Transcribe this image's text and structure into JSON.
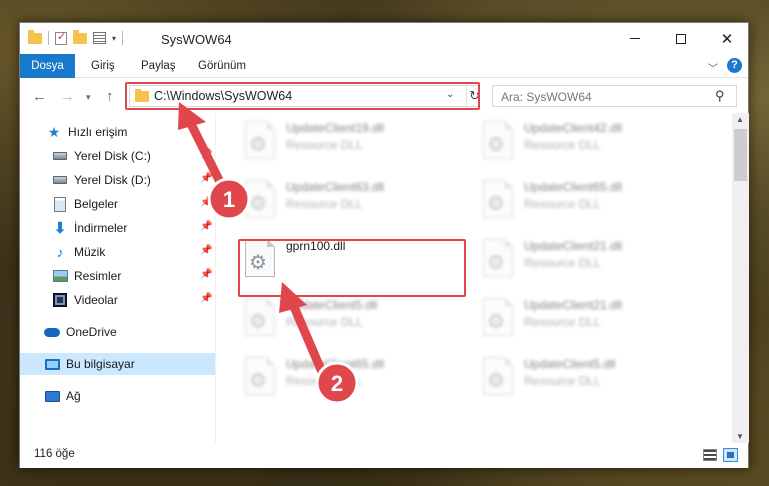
{
  "window": {
    "title": "SysWOW64"
  },
  "ribbon": {
    "tabs": [
      {
        "label": "Dosya"
      },
      {
        "label": "Giriş"
      },
      {
        "label": "Paylaş"
      },
      {
        "label": "Görünüm"
      }
    ],
    "accent": "#1979ca",
    "help_label": "?"
  },
  "navigation": {
    "address": "C:\\Windows\\SysWOW64",
    "search_placeholder": "Ara: SysWOW64"
  },
  "sidebar": {
    "items": [
      {
        "label": "Hızlı erişim",
        "icon": "star-icon"
      },
      {
        "label": "Yerel Disk (C:)",
        "icon": "disk-icon"
      },
      {
        "label": "Yerel Disk (D:)",
        "icon": "disk-icon"
      },
      {
        "label": "Belgeler",
        "icon": "document-icon"
      },
      {
        "label": "İndirmeler",
        "icon": "download-icon"
      },
      {
        "label": "Müzik",
        "icon": "music-icon"
      },
      {
        "label": "Resimler",
        "icon": "pictures-icon"
      },
      {
        "label": "Videolar",
        "icon": "video-icon"
      },
      {
        "label": "OneDrive",
        "icon": "cloud-icon"
      },
      {
        "label": "Bu bilgisayar",
        "icon": "computer-icon",
        "selected": true
      },
      {
        "label": "Ağ",
        "icon": "network-icon"
      }
    ]
  },
  "files": [
    {
      "name": "UpdateClient19.dll",
      "type": "Resource DLL"
    },
    {
      "name": "UpdateClient42.dll",
      "type": "Resource DLL"
    },
    {
      "name": "UpdateClient63.dll",
      "type": "Resource DLL"
    },
    {
      "name": "UpdateClient65.dll",
      "type": "Resource DLL"
    },
    {
      "name": "gprn100.dll",
      "type": ""
    },
    {
      "name": "UpdateClient21.dll",
      "type": "Resource DLL"
    },
    {
      "name": "UpdateClient5.dll",
      "type": "Resource DLL"
    },
    {
      "name": "UpdateClient21.dll",
      "type": "Resource DLL"
    },
    {
      "name": "UpdateClient65.dll",
      "type": "Resource DLL"
    },
    {
      "name": "UpdateClient5.dll",
      "type": "Resource DLL"
    }
  ],
  "status": {
    "item_count": "116 öğe"
  },
  "annotations": {
    "color": "#e0474c",
    "step1": "1",
    "step2": "2"
  }
}
